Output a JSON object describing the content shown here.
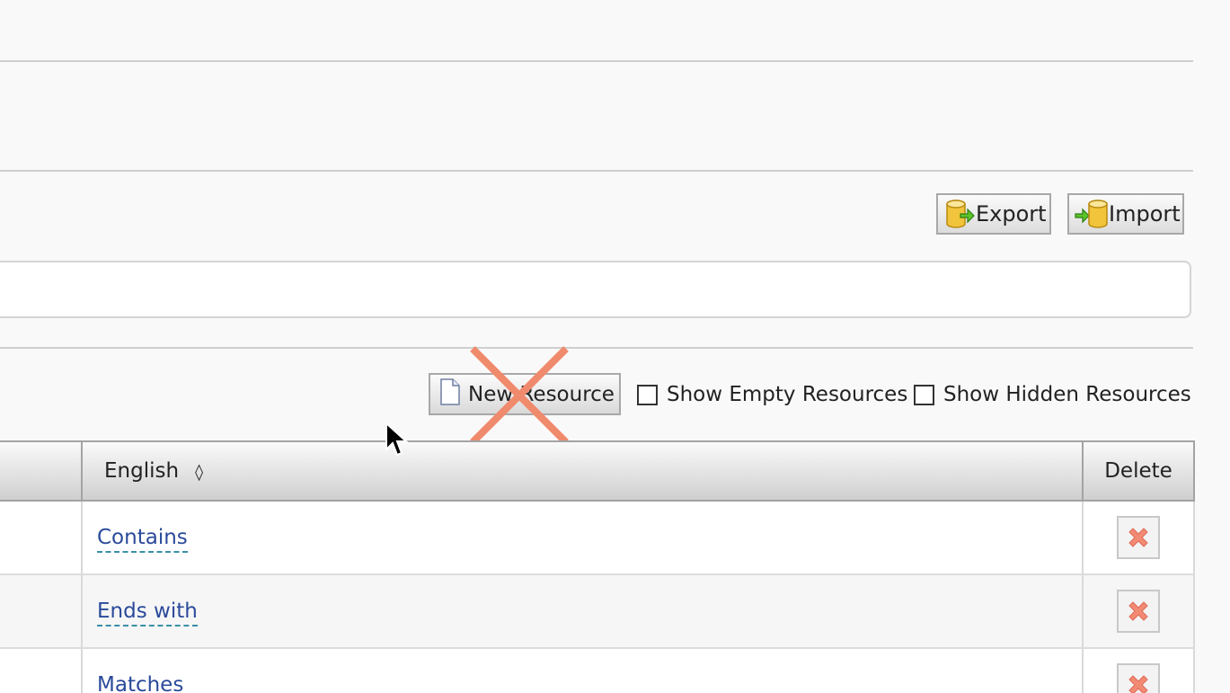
{
  "toolbar": {
    "export_label": "Export",
    "import_label": "Import"
  },
  "resources_bar": {
    "new_resource_label": "New Resource",
    "show_empty_label": "Show Empty Resources",
    "show_hidden_label": "Show Hidden Resources"
  },
  "table": {
    "columns": {
      "english": "English",
      "sort_indicator": "◊",
      "delete": "Delete"
    },
    "rows": [
      {
        "english": "Contains"
      },
      {
        "english": "Ends with"
      },
      {
        "english": "Matches"
      }
    ]
  },
  "colors": {
    "link": "#2a4a9a",
    "link_underline": "#3a8fa8",
    "delete_icon": "#f28a74",
    "overlay_cross": "#f08a6c"
  },
  "icons": {
    "export": "database-export-icon",
    "import": "database-import-icon",
    "new_resource": "document-icon",
    "delete": "red-x-icon"
  }
}
